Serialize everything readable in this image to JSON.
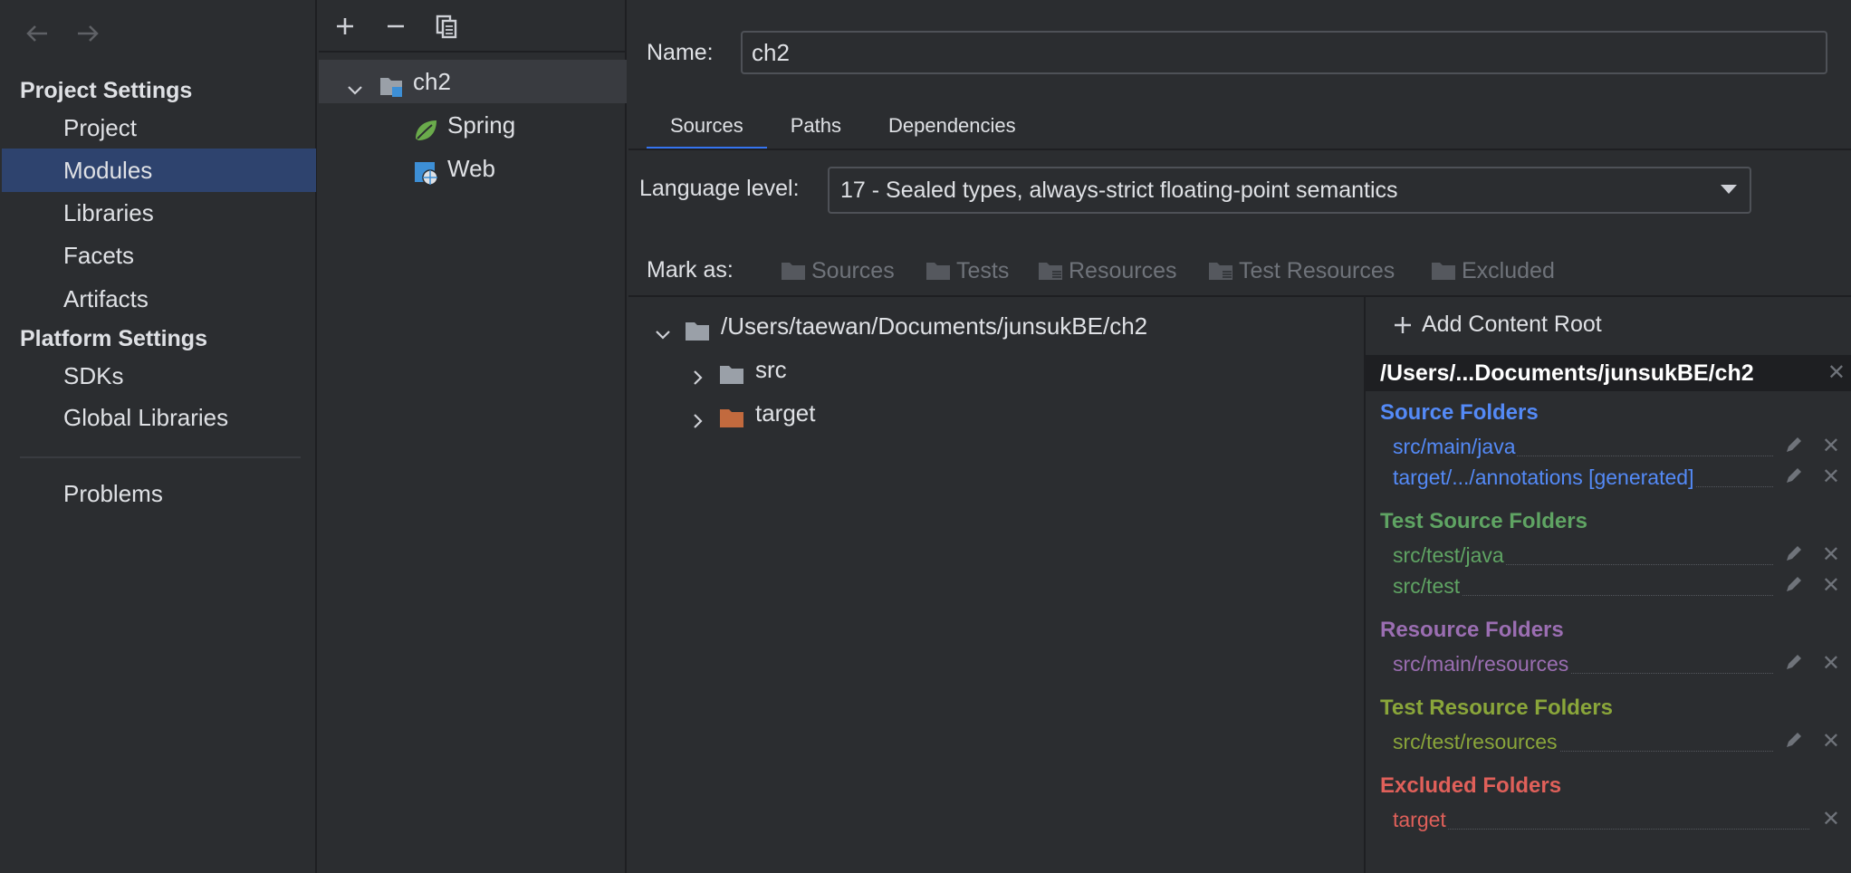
{
  "sidebar": {
    "back_icon": "arrow-left-icon",
    "forward_icon": "arrow-right-icon",
    "project_settings_title": "Project Settings",
    "project_items": [
      "Project",
      "Modules",
      "Libraries",
      "Facets",
      "Artifacts"
    ],
    "selected": "Modules",
    "platform_settings_title": "Platform Settings",
    "platform_items": [
      "SDKs",
      "Global Libraries"
    ],
    "problems": "Problems"
  },
  "modules": {
    "toolbar": {
      "add_icon": "plus-icon",
      "remove_icon": "minus-icon",
      "copy_icon": "copy-icon"
    },
    "root": "ch2",
    "facets": [
      "Spring",
      "Web"
    ]
  },
  "main": {
    "name_label": "Name:",
    "name_value": "ch2",
    "tabs": [
      "Sources",
      "Paths",
      "Dependencies"
    ],
    "active_tab": "Sources",
    "language_label": "Language level:",
    "language_value": "17 - Sealed types, always-strict floating-point semantics",
    "mark_as_label": "Mark as:",
    "mark_buttons": [
      "Sources",
      "Tests",
      "Resources",
      "Test Resources",
      "Excluded"
    ],
    "tree": {
      "root_path": "/Users/taewan/Documents/junsukBE/ch2",
      "children": [
        "src",
        "target"
      ]
    }
  },
  "content_root": {
    "add_label": "Add Content Root",
    "root_header": "/Users/...Documents/junsukBE/ch2",
    "source_title": "Source Folders",
    "source_folders": [
      "src/main/java",
      "target/.../annotations [generated]"
    ],
    "test_source_title": "Test Source Folders",
    "test_source_folders": [
      "src/test/java",
      "src/test"
    ],
    "resource_title": "Resource Folders",
    "resource_folders": [
      "src/main/resources"
    ],
    "test_resource_title": "Test Resource Folders",
    "test_resource_folders": [
      "src/test/resources"
    ],
    "excluded_title": "Excluded Folders",
    "excluded_folders": [
      "target"
    ]
  },
  "colors": {
    "accent": "#3574f0",
    "selection": "#2e436e",
    "source": "#548af7",
    "test": "#5fa463",
    "resource": "#9b6eb2",
    "test_resource": "#8aa63a",
    "excluded": "#e0605a",
    "target_folder": "#c26a3e"
  }
}
